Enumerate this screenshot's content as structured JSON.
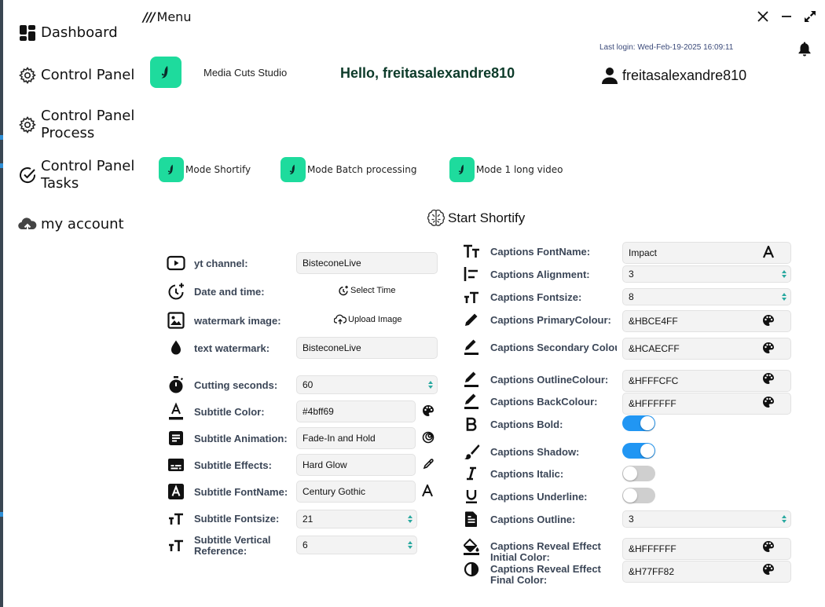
{
  "sidebar": {
    "items": [
      {
        "label": "Dashboard",
        "icon": "dashboard-icon"
      },
      {
        "label": "Control Panel",
        "icon": "gear-icon"
      },
      {
        "label": "Control Panel\nProcess",
        "icon": "gear-icon"
      },
      {
        "label": "Control Panel\nTasks",
        "icon": "check-circle-icon"
      },
      {
        "label": "my account",
        "icon": "cloud-upload-icon"
      }
    ]
  },
  "header": {
    "menu_label": "Menu",
    "last_login": "Last login: Wed-Feb-19-2025  16:09:11",
    "studio_name": "Media Cuts Studio",
    "greeting": "Hello, freitasalexandre810",
    "username": "freitasalexandre810"
  },
  "modes": [
    {
      "label": "Mode Shortify"
    },
    {
      "label": "Mode Batch processing"
    },
    {
      "label": "Mode 1 long video"
    }
  ],
  "start_label": "Start Shortify",
  "left_form": {
    "yt_channel": {
      "label": "yt channel:",
      "value": "BisteconeLive"
    },
    "date_time": {
      "label": "Date and time:",
      "button": "Select Time"
    },
    "watermark_image": {
      "label": "watermark image:",
      "button": "Upload Image"
    },
    "text_watermark": {
      "label": "text watermark:",
      "value": "BisteconeLive"
    },
    "cutting_seconds": {
      "label": "Cutting seconds:",
      "value": "60"
    },
    "subtitle_color": {
      "label": "Subtitle Color:",
      "value": "#4bff69"
    },
    "subtitle_animation": {
      "label": "Subtitle Animation:",
      "value": "Fade-In and Hold"
    },
    "subtitle_effects": {
      "label": "Subtitle Effects:",
      "value": "Hard Glow"
    },
    "subtitle_fontname": {
      "label": "Subtitle FontName:",
      "value": "Century Gothic"
    },
    "subtitle_fontsize": {
      "label": "Subtitle Fontsize:",
      "value": "21"
    },
    "subtitle_vertical": {
      "label": "Subtitle Vertical\nReference:",
      "value": "6"
    }
  },
  "right_form": {
    "captions_fontname": {
      "label": "Captions FontName:",
      "value": "Impact"
    },
    "captions_alignment": {
      "label": "Captions Alignment:",
      "value": "3"
    },
    "captions_fontsize": {
      "label": "Captions Fontsize:",
      "value": "8"
    },
    "captions_primary": {
      "label": "Captions PrimaryColour:",
      "value": "&HBCE4FF"
    },
    "captions_secondary": {
      "label": "Captions Secondary Colou",
      "value": "&HCAECFF"
    },
    "captions_outline_colour": {
      "label": "Captions OutlineColour:",
      "value": "&HFFFCFC"
    },
    "captions_back": {
      "label": "Captions BackColour:",
      "value": "&HFFFFFF"
    },
    "captions_bold": {
      "label": "Captions Bold:",
      "enabled": true
    },
    "captions_shadow": {
      "label": "Captions Shadow:",
      "enabled": true
    },
    "captions_italic": {
      "label": "Captions Italic:",
      "enabled": false
    },
    "captions_underline": {
      "label": "Captions Underline:",
      "enabled": false
    },
    "captions_outline": {
      "label": "Captions Outline:",
      "value": "3"
    },
    "captions_reveal_initial": {
      "label": "Captions Reveal Effect\nInitial Color:",
      "value": "&HFFFFFF"
    },
    "captions_reveal_final": {
      "label": "Captions Reveal Effect\nFinal Color:",
      "value": "&H77FF82"
    }
  },
  "colors": {
    "accent": "#1edb9d",
    "toggle_on": "#2196f3",
    "label": "#3b4657"
  }
}
